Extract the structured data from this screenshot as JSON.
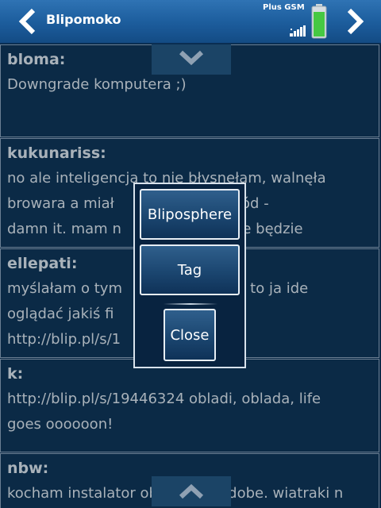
{
  "header": {
    "title": "Blipomoko",
    "carrier": "Plus GSM",
    "back_icon": "chevron-left-icon",
    "forward_icon": "chevron-right-icon",
    "battery_level": 0.85,
    "accent_color": "#2f73b4"
  },
  "feed": {
    "posts": [
      {
        "author": "bloma:",
        "message": "Downgrade komputera ;)"
      },
      {
        "author": "kukunariss:",
        "message": "no ale inteligencja to nie błysnęłam, walnęła\nbrowara a miał             ć samochód -\ndamn it. mam n               c mu nie będzie"
      },
      {
        "author": "ellepati:",
        "message": "myślałam o tym              po winie to ja ide\noglądać jakiś fi              ROWIE!\nhttp://blip.pl/s/1"
      },
      {
        "author": "k:",
        "message": "http://blip.pl/s/19446324 obladi, oblada, life\ngoes oooooon!"
      },
      {
        "author": "nbw:",
        "message": "kocham instalator ob      wan adobe. wiatraki n"
      }
    ],
    "scroll_up_icon": "chevron-down-icon",
    "scroll_down_icon": "chevron-up-icon"
  },
  "popup": {
    "buttons": [
      "Bliposphere",
      "Tag"
    ],
    "close_label": "Close"
  }
}
